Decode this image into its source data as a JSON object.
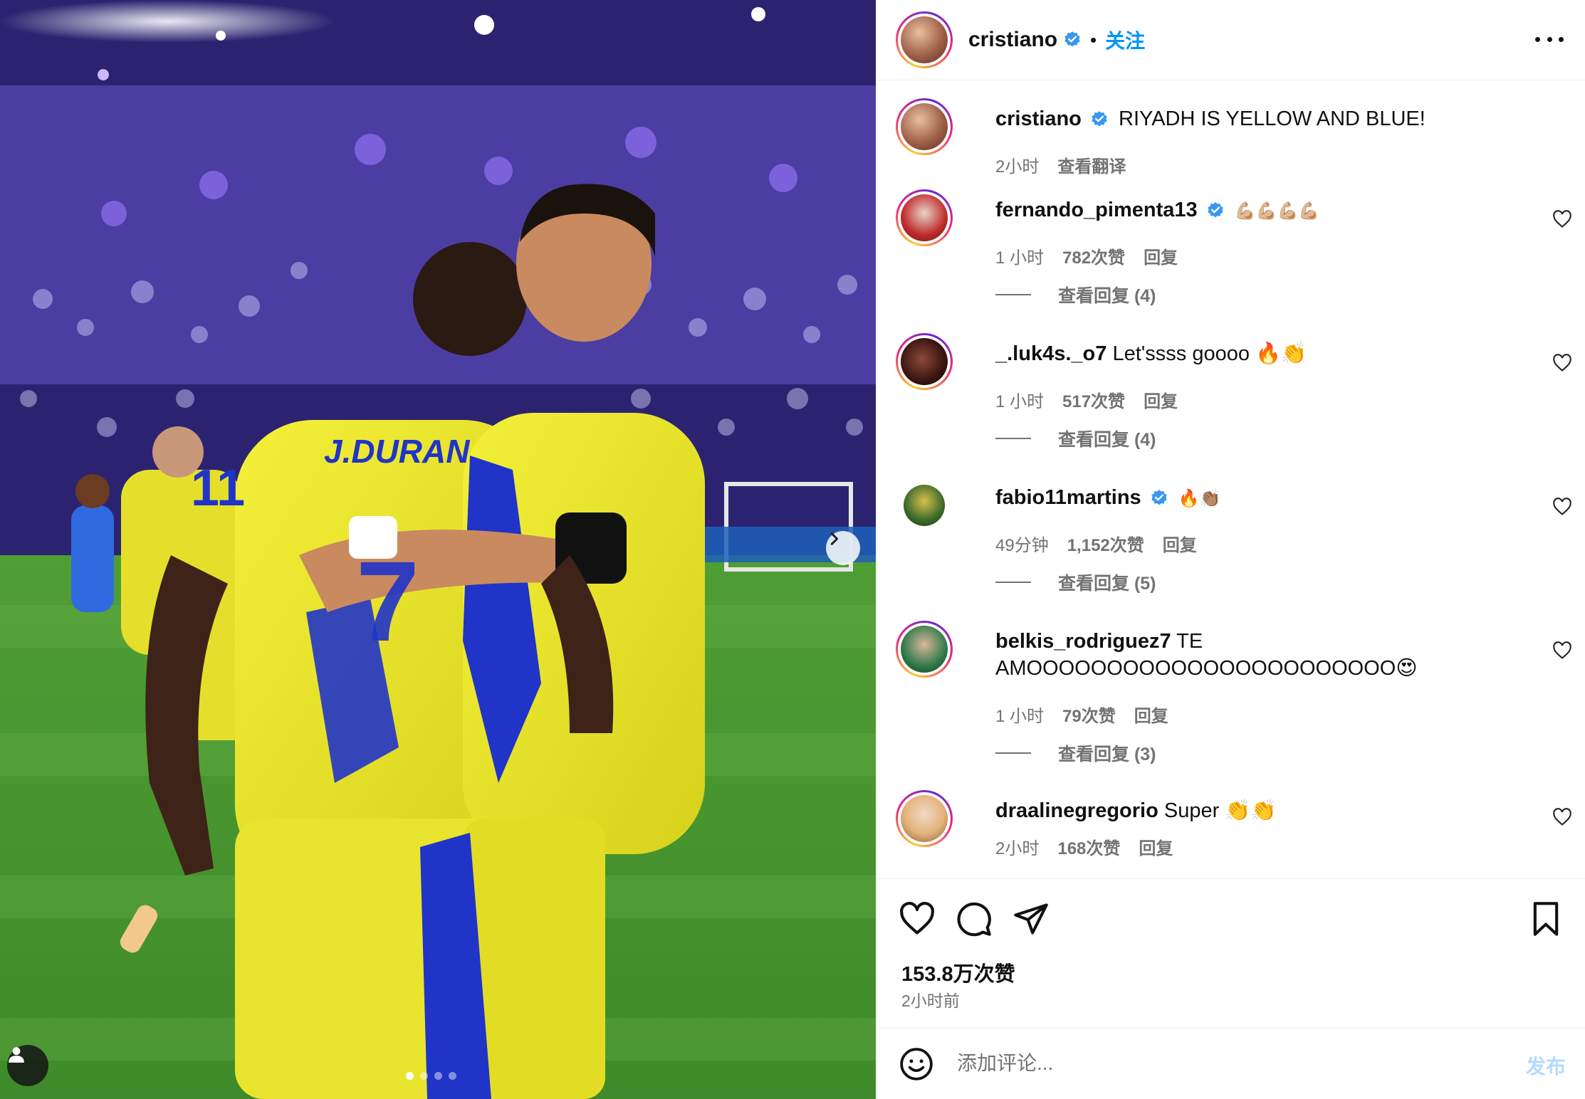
{
  "post": {
    "author": "cristiano",
    "follow_label": "关注",
    "separator": "•",
    "likes": "153.8万次赞",
    "time_ago": "2小时前",
    "carousel_pages": 4,
    "carousel_active": 1
  },
  "caption": {
    "username": "cristiano",
    "text": "RIYADH IS YELLOW AND BLUE!",
    "time": "2小时",
    "translate_label": "查看翻译"
  },
  "comments": [
    {
      "username": "fernando_pimenta13",
      "verified": true,
      "text": "💪🏼💪🏼💪🏼💪🏼",
      "time": "1 小时",
      "likes": "782次赞",
      "reply_label": "回复",
      "view_replies": "查看回复 (4)"
    },
    {
      "username": "_.luk4s._o7",
      "verified": false,
      "text": "Let'ssss goooo 🔥👏",
      "time": "1 小时",
      "likes": "517次赞",
      "reply_label": "回复",
      "view_replies": "查看回复 (4)"
    },
    {
      "username": "fabio11martins",
      "verified": true,
      "text": "🔥👏🏽",
      "time": "49分钟",
      "likes": "1,152次赞",
      "reply_label": "回复",
      "view_replies": "查看回复 (5)"
    },
    {
      "username": "belkis_rodriguez7",
      "verified": false,
      "text": "TE AMOOOOOOOOOOOOOOOOOOOOOOO😍",
      "time": "1 小时",
      "likes": "79次赞",
      "reply_label": "回复",
      "view_replies": "查看回复 (3)"
    },
    {
      "username": "draalinegregorio",
      "verified": false,
      "text": "Super 👏👏",
      "time": "2小时",
      "likes": "168次赞",
      "reply_label": "回复",
      "view_replies": ""
    }
  ],
  "composer": {
    "placeholder": "添加评论...",
    "post_label": "发布"
  },
  "jersey": {
    "name": "J.DURAN"
  },
  "icons": {
    "verified": "verified-badge-icon",
    "more": "more-options-icon",
    "heart": "heart-icon",
    "comment": "comment-icon",
    "share": "share-icon",
    "save": "bookmark-icon",
    "emoji": "emoji-icon",
    "next": "chevron-right-icon",
    "user_tag": "user-tag-icon"
  },
  "colors": {
    "accent": "#0095f6",
    "verified": "#3897f0",
    "muted": "#737373",
    "post_disabled": "#b3dbff"
  }
}
